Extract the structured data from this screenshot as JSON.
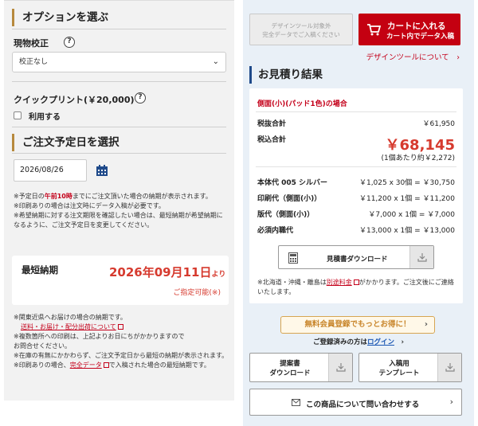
{
  "left": {
    "options_title": "オプションを選ぶ",
    "proof_label": "現物校正",
    "help_glyph": "?",
    "proof_select": "校正なし",
    "quick_label": "クイックプリント(￥20,000)",
    "quick_check_label": "利用する",
    "order_title": "ご注文予定日を選択",
    "order_date": "2026/08/26",
    "notes": {
      "n1_a": "※予定日の",
      "n1_red": "午前10時",
      "n1_b": "までにご注文頂いた場合の納期が表示されます。",
      "n2": "※印刷ありの場合は注文時にデータ入稿が必要です。",
      "n3": "※希望納期に対する注文期限を確認したい場合は、最短納期が希望納期になるように、ご注文予定日を変更してください。"
    },
    "shortest": {
      "title": "最短納期",
      "date": "2026年09月11日",
      "date_suffix": "より",
      "sub": "ご指定可能(※)"
    },
    "bottom_notes": {
      "b1": "※関東近県へお届けの場合の納期です。",
      "b1_link": "送料・お届け・配分出荷について",
      "b2": "※複数箇所への印刷は、上記よりお日にちがかかりますので",
      "b2b": "お問合せください。",
      "b3": "※在庫の有無にかかわらず、ご注文予定日から最短の納期が表示されます。",
      "b4_a": "※印刷ありの場合、",
      "b4_link": "完全データ",
      "b4_b": "で入稿された場合の最短納期です。"
    }
  },
  "right": {
    "design_btn": "デザインツール対象外\n完全データでご入稿ください",
    "cart_btn_1": "カートに入れる",
    "cart_btn_2": "カート内でデータ入稿",
    "design_link": "デザインツールについて",
    "result_title": "お見積り結果",
    "case": "側面(小)(パッド1色)の場合",
    "rows": {
      "subtotal_l": "税抜合計",
      "subtotal_r": "￥61,950",
      "total_l": "税込合計",
      "total_r": "￥68,145",
      "per_unit": "(1個あたり約￥2,272)",
      "body_l": "本体代 005 シルバー",
      "body_r": "￥1,025 x 30個 = ￥30,750",
      "print_l": "印刷代（側面(小)）",
      "print_r": "￥11,200 x 1個 = ￥11,200",
      "plate_l": "版代（側面(小)）",
      "plate_r": "￥7,000 x 1個 = ￥7,000",
      "labor_l": "必須内職代",
      "labor_r": "￥13,000 x 1個 = ￥13,000"
    },
    "quote_btn": "見積書ダウンロード",
    "note_a": "※北海道・沖縄・離島は",
    "note_link": "別途料金",
    "note_b": "がかかります。ご注文後にご連絡いたします。",
    "member_btn": "無料会員登録でもっとお得に！",
    "login_a": "ご登録済みの方は",
    "login_link": "ログイン",
    "proposal_1": "提案書",
    "proposal_2": "ダウンロード",
    "template_1": "入稿用",
    "template_2": "テンプレート",
    "contact_btn": "この商品について問い合わせする"
  },
  "colors": {
    "accent_gold": "#b7893d",
    "accent_blue": "#1f4a8a",
    "cart_red": "#c40011",
    "price_red": "#d63a2e"
  }
}
